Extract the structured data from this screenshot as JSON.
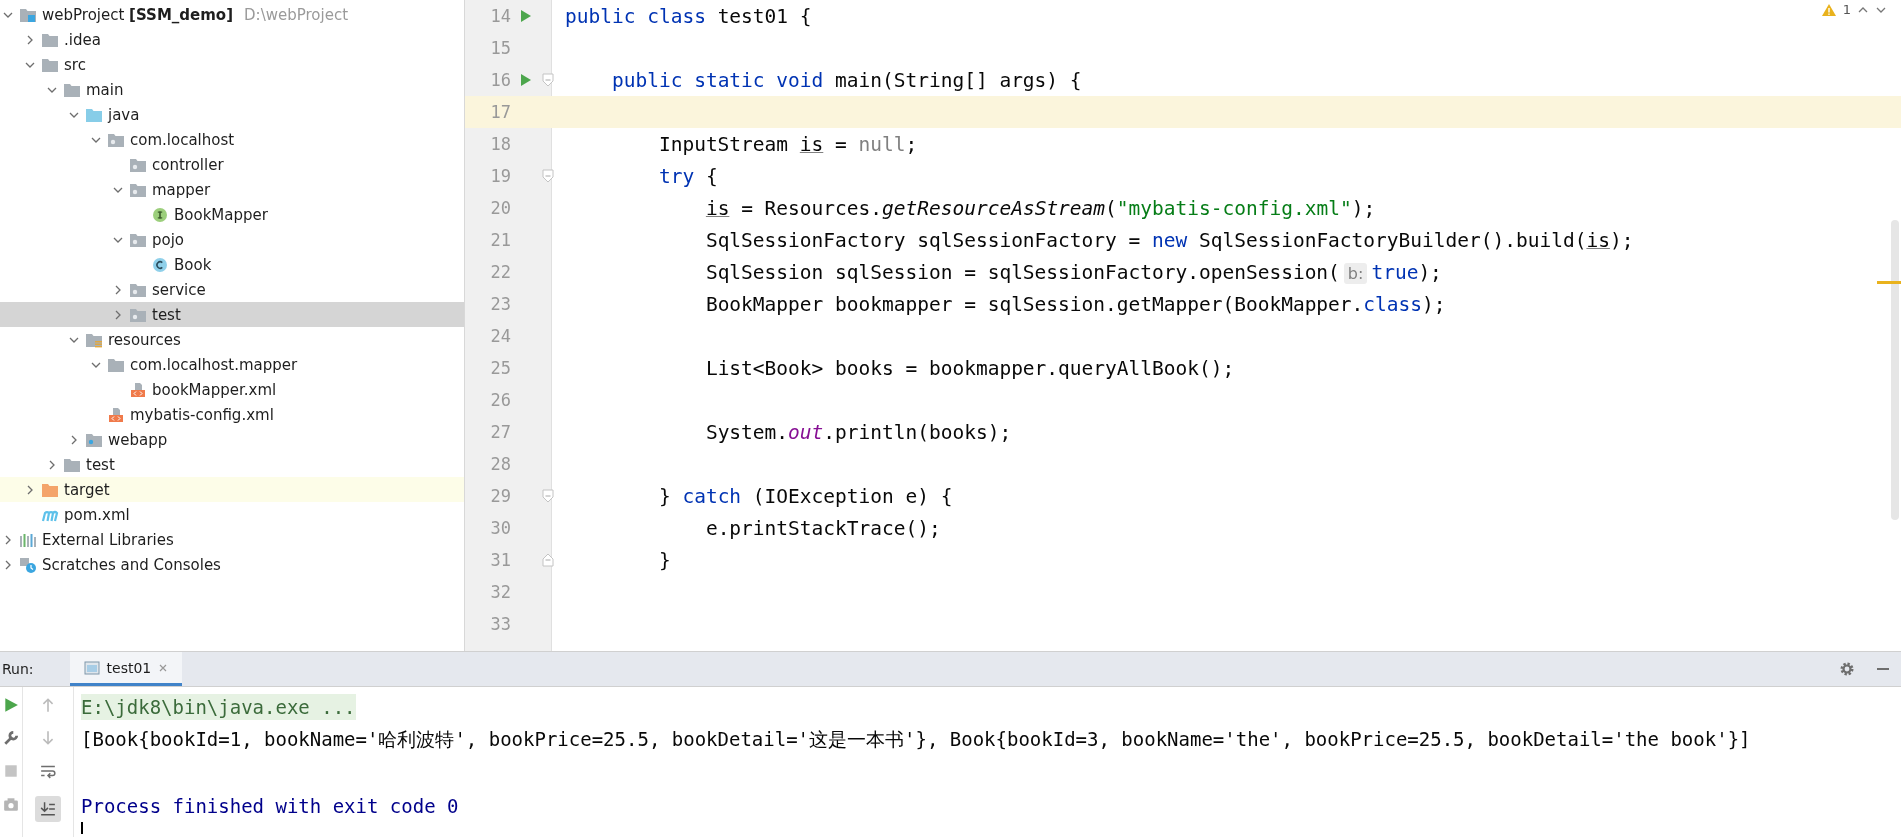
{
  "project_tree": [
    {
      "label": "webProject **[SSM_demo]**",
      "path": "D:\\webProject",
      "kind": "project",
      "expanded": true,
      "selected": false,
      "children": [
        {
          "label": ".idea",
          "kind": "folder",
          "expanded": false,
          "selected": false
        },
        {
          "label": "src",
          "kind": "folder",
          "expanded": true,
          "selected": false,
          "children": [
            {
              "label": "main",
              "kind": "folder",
              "expanded": true,
              "selected": false,
              "children": [
                {
                  "label": "java",
                  "kind": "source_folder",
                  "expanded": true,
                  "selected": false,
                  "children": [
                    {
                      "label": "com.localhost",
                      "kind": "package",
                      "expanded": true,
                      "selected": false,
                      "children": [
                        {
                          "label": "controller",
                          "kind": "package",
                          "selected": false
                        },
                        {
                          "label": "mapper",
                          "kind": "package",
                          "expanded": true,
                          "selected": false,
                          "children": [
                            {
                              "label": "BookMapper",
                              "kind": "interface",
                              "selected": false
                            }
                          ]
                        },
                        {
                          "label": "pojo",
                          "kind": "package",
                          "expanded": true,
                          "selected": false,
                          "children": [
                            {
                              "label": "Book",
                              "kind": "class",
                              "selected": false
                            }
                          ]
                        },
                        {
                          "label": "service",
                          "kind": "package",
                          "expanded": false,
                          "selected": false
                        },
                        {
                          "label": "test",
                          "kind": "package",
                          "expanded": false,
                          "selected": true
                        }
                      ]
                    }
                  ]
                },
                {
                  "label": "resources",
                  "kind": "resources_folder",
                  "expanded": true,
                  "selected": false,
                  "children": [
                    {
                      "label": "com.localhost.mapper",
                      "kind": "folder",
                      "expanded": true,
                      "selected": false,
                      "children": [
                        {
                          "label": "bookMapper.xml",
                          "kind": "xml",
                          "selected": false
                        }
                      ]
                    },
                    {
                      "label": "mybatis-config.xml",
                      "kind": "xml",
                      "selected": false
                    }
                  ]
                },
                {
                  "label": "webapp",
                  "kind": "web_folder",
                  "expanded": false,
                  "selected": false
                }
              ]
            },
            {
              "label": "test",
              "kind": "folder",
              "expanded": false,
              "selected": false
            }
          ]
        },
        {
          "label": "target",
          "kind": "excluded_folder",
          "expanded": false,
          "selected": false
        },
        {
          "label": "pom.xml",
          "kind": "maven",
          "selected": false
        }
      ]
    },
    {
      "label": "External Libraries",
      "kind": "libraries",
      "expanded": false,
      "selected": false
    },
    {
      "label": "Scratches and Consoles",
      "kind": "scratches",
      "expanded": false,
      "selected": false
    }
  ],
  "editor": {
    "warning_count": "1",
    "lines": [
      {
        "number": "14",
        "run": true,
        "current": false,
        "segments": [
          {
            "text": "public class ",
            "kind": "keyword"
          },
          {
            "text": "test01 {",
            "kind": "plain"
          }
        ]
      },
      {
        "number": "15",
        "run": false,
        "current": false
      },
      {
        "number": "16",
        "run": true,
        "fold_start": true,
        "current": false,
        "segments": [
          {
            "text": "    public static void ",
            "kind": "keyword"
          },
          {
            "text": "main(String[] args) {",
            "kind": "plain"
          }
        ]
      },
      {
        "number": "17",
        "run": false,
        "current": true
      },
      {
        "number": "18",
        "run": false,
        "current": false,
        "segments": [
          {
            "text": "        InputStream ",
            "kind": "plain"
          },
          {
            "text": "is",
            "kind": "reassigned"
          },
          {
            "text": " = ",
            "kind": "plain"
          },
          {
            "text": "null",
            "kind": "muted"
          },
          {
            "text": ";",
            "kind": "plain"
          }
        ]
      },
      {
        "number": "19",
        "run": false,
        "fold_start": true,
        "current": false,
        "segments": [
          {
            "text": "        try ",
            "kind": "keyword"
          },
          {
            "text": "{",
            "kind": "plain"
          }
        ]
      },
      {
        "number": "20",
        "run": false,
        "current": false,
        "segments": [
          {
            "text": "            is",
            "kind": "reassigned"
          },
          {
            "text": " = Resources.",
            "kind": "plain"
          },
          {
            "text": "getResourceAsStream",
            "kind": "static_method"
          },
          {
            "text": "(",
            "kind": "plain"
          },
          {
            "text": "\"mybatis-config.xml\"",
            "kind": "string"
          },
          {
            "text": ");",
            "kind": "plain"
          }
        ]
      },
      {
        "number": "21",
        "run": false,
        "current": false,
        "segments": [
          {
            "text": "            SqlSessionFactory sqlSessionFactory = ",
            "kind": "plain"
          },
          {
            "text": "new ",
            "kind": "keyword"
          },
          {
            "text": "SqlSessionFactoryBuilder().build(",
            "kind": "plain"
          },
          {
            "text": "is",
            "kind": "reassigned"
          },
          {
            "text": ");",
            "kind": "plain"
          }
        ]
      },
      {
        "number": "22",
        "run": false,
        "current": false,
        "segments": [
          {
            "text": "            SqlSession sqlSession = sqlSessionFactory.openSession(",
            "kind": "plain"
          },
          {
            "text": "b:",
            "kind": "hint"
          },
          {
            "text": "true",
            "kind": "keyword"
          },
          {
            "text": ");",
            "kind": "plain"
          }
        ]
      },
      {
        "number": "23",
        "run": false,
        "current": false,
        "segments": [
          {
            "text": "            BookMapper bookmapper = sqlSession.getMapper(BookMapper.",
            "kind": "plain"
          },
          {
            "text": "class",
            "kind": "keyword"
          },
          {
            "text": ");",
            "kind": "plain"
          }
        ]
      },
      {
        "number": "24",
        "run": false,
        "current": false
      },
      {
        "number": "25",
        "run": false,
        "current": false,
        "segments": [
          {
            "text": "            List<Book> books = bookmapper.queryAllBook();",
            "kind": "plain"
          }
        ]
      },
      {
        "number": "26",
        "run": false,
        "current": false
      },
      {
        "number": "27",
        "run": false,
        "current": false,
        "segments": [
          {
            "text": "            System.",
            "kind": "plain"
          },
          {
            "text": "out",
            "kind": "static_field"
          },
          {
            "text": ".println(books);",
            "kind": "plain"
          }
        ]
      },
      {
        "number": "28",
        "run": false,
        "current": false
      },
      {
        "number": "29",
        "run": false,
        "fold_start": true,
        "current": false,
        "segments": [
          {
            "text": "        } ",
            "kind": "plain"
          },
          {
            "text": "catch ",
            "kind": "keyword"
          },
          {
            "text": "(IOException e) {",
            "kind": "plain"
          }
        ]
      },
      {
        "number": "30",
        "run": false,
        "current": false,
        "segments": [
          {
            "text": "            e.printStackTrace();",
            "kind": "plain"
          }
        ]
      },
      {
        "number": "31",
        "run": false,
        "fold_end": true,
        "current": false,
        "segments": [
          {
            "text": "        }",
            "kind": "plain"
          }
        ]
      },
      {
        "number": "32",
        "run": false,
        "current": false
      },
      {
        "number": "33",
        "run": false,
        "current": false
      }
    ]
  },
  "run_panel": {
    "label": "Run:",
    "tabs": [
      {
        "label": "test01",
        "selected": true
      }
    ],
    "console": [
      {
        "text": "E:\\jdk8\\bin\\java.exe ...",
        "kind": "command"
      },
      {
        "text": "[Book{bookId=1, bookName='哈利波特', bookPrice=25.5, bookDetail='这是一本书'}, Book{bookId=3, bookName='the', bookPrice=25.5, bookDetail='the book'}]",
        "kind": "output"
      },
      {
        "text": "Process finished with exit code 0",
        "kind": "system"
      }
    ]
  }
}
